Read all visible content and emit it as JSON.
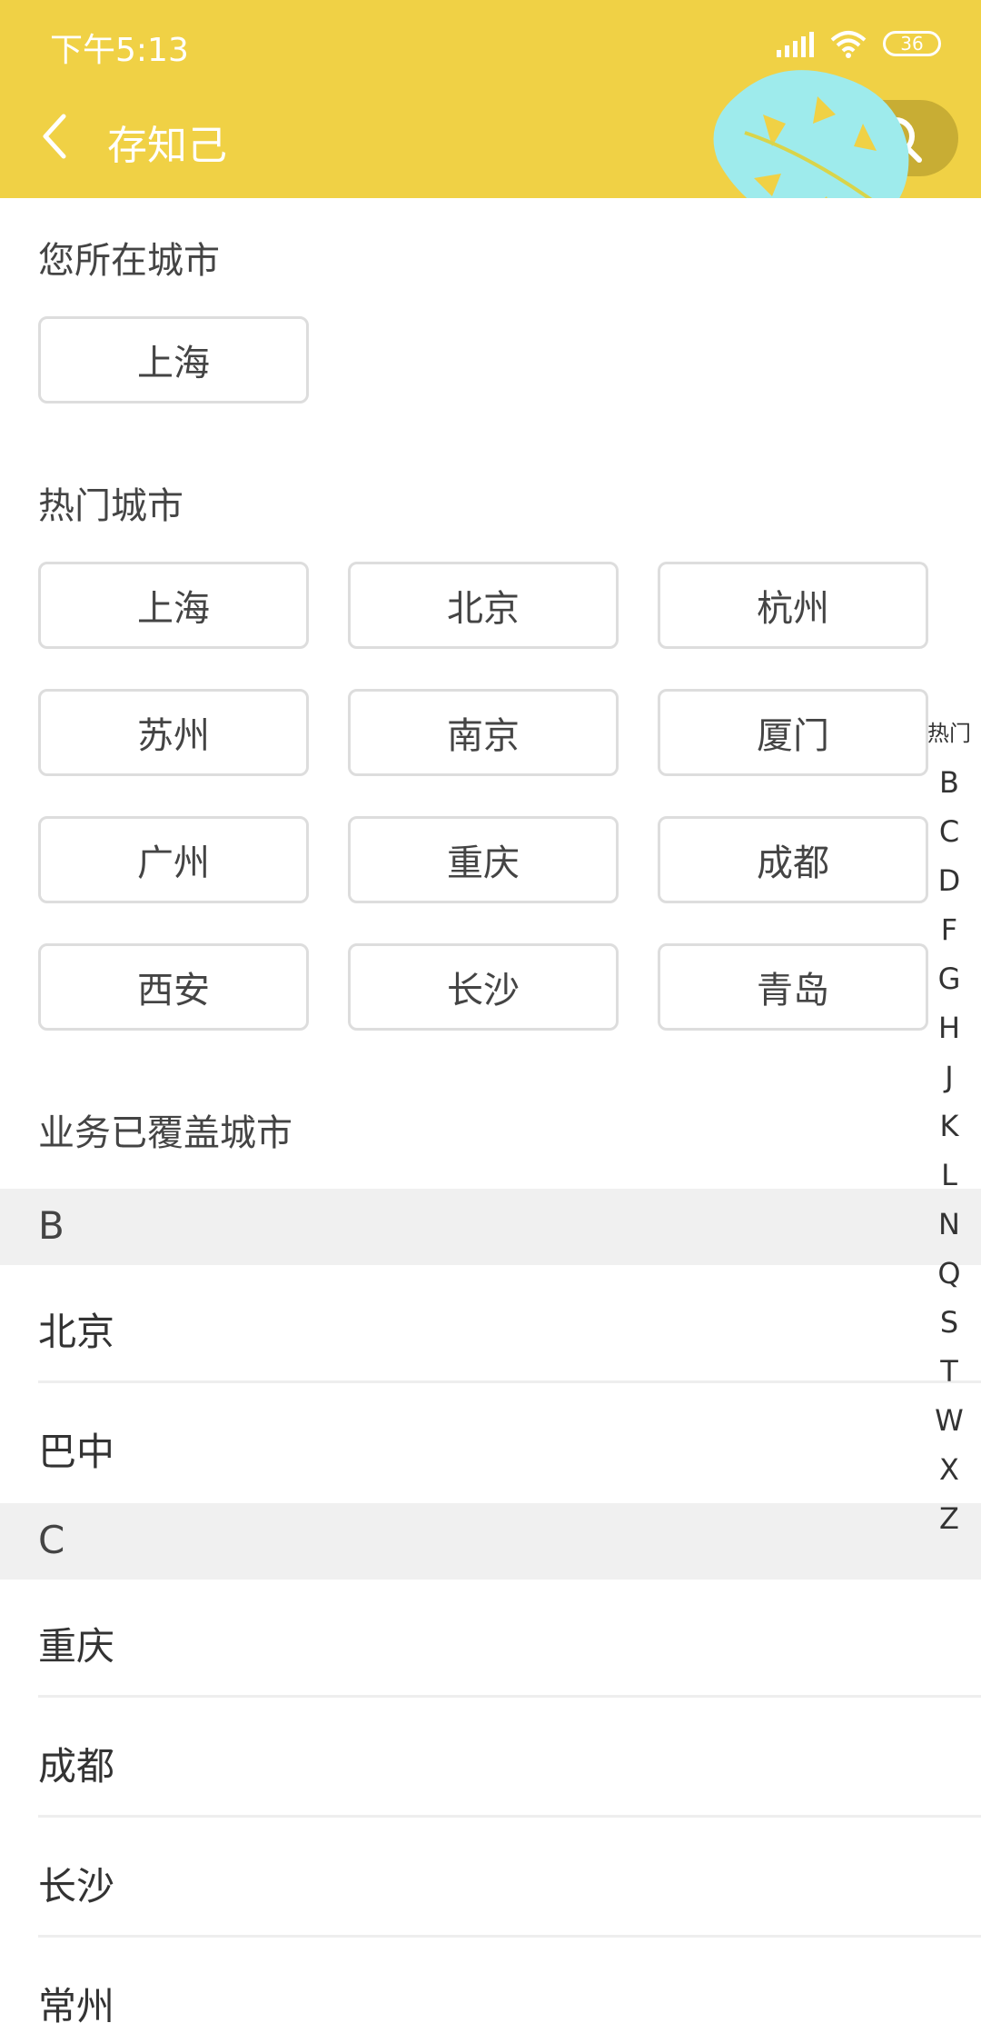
{
  "status_bar": {
    "time": "下午5:13",
    "battery": "36"
  },
  "header": {
    "title": "存知己"
  },
  "current_city": {
    "title": "您所在城市",
    "city": "上海"
  },
  "hot_cities": {
    "title": "热门城市",
    "cities": [
      "上海",
      "北京",
      "杭州",
      "苏州",
      "南京",
      "厦门",
      "广州",
      "重庆",
      "成都",
      "西安",
      "长沙",
      "青岛"
    ]
  },
  "covered": {
    "title": "业务已覆盖城市",
    "groups": [
      {
        "letter": "B",
        "cities": [
          "北京",
          "巴中"
        ]
      },
      {
        "letter": "C",
        "cities": [
          "重庆",
          "成都",
          "长沙",
          "常州"
        ]
      }
    ]
  },
  "index_bar": [
    "热门",
    "B",
    "C",
    "D",
    "F",
    "G",
    "H",
    "J",
    "K",
    "L",
    "N",
    "Q",
    "S",
    "T",
    "W",
    "X",
    "Z"
  ],
  "colors": {
    "header_bg": "#F0D145",
    "search_pill": "#C8AD34",
    "leaf": "#9EEBEC"
  }
}
